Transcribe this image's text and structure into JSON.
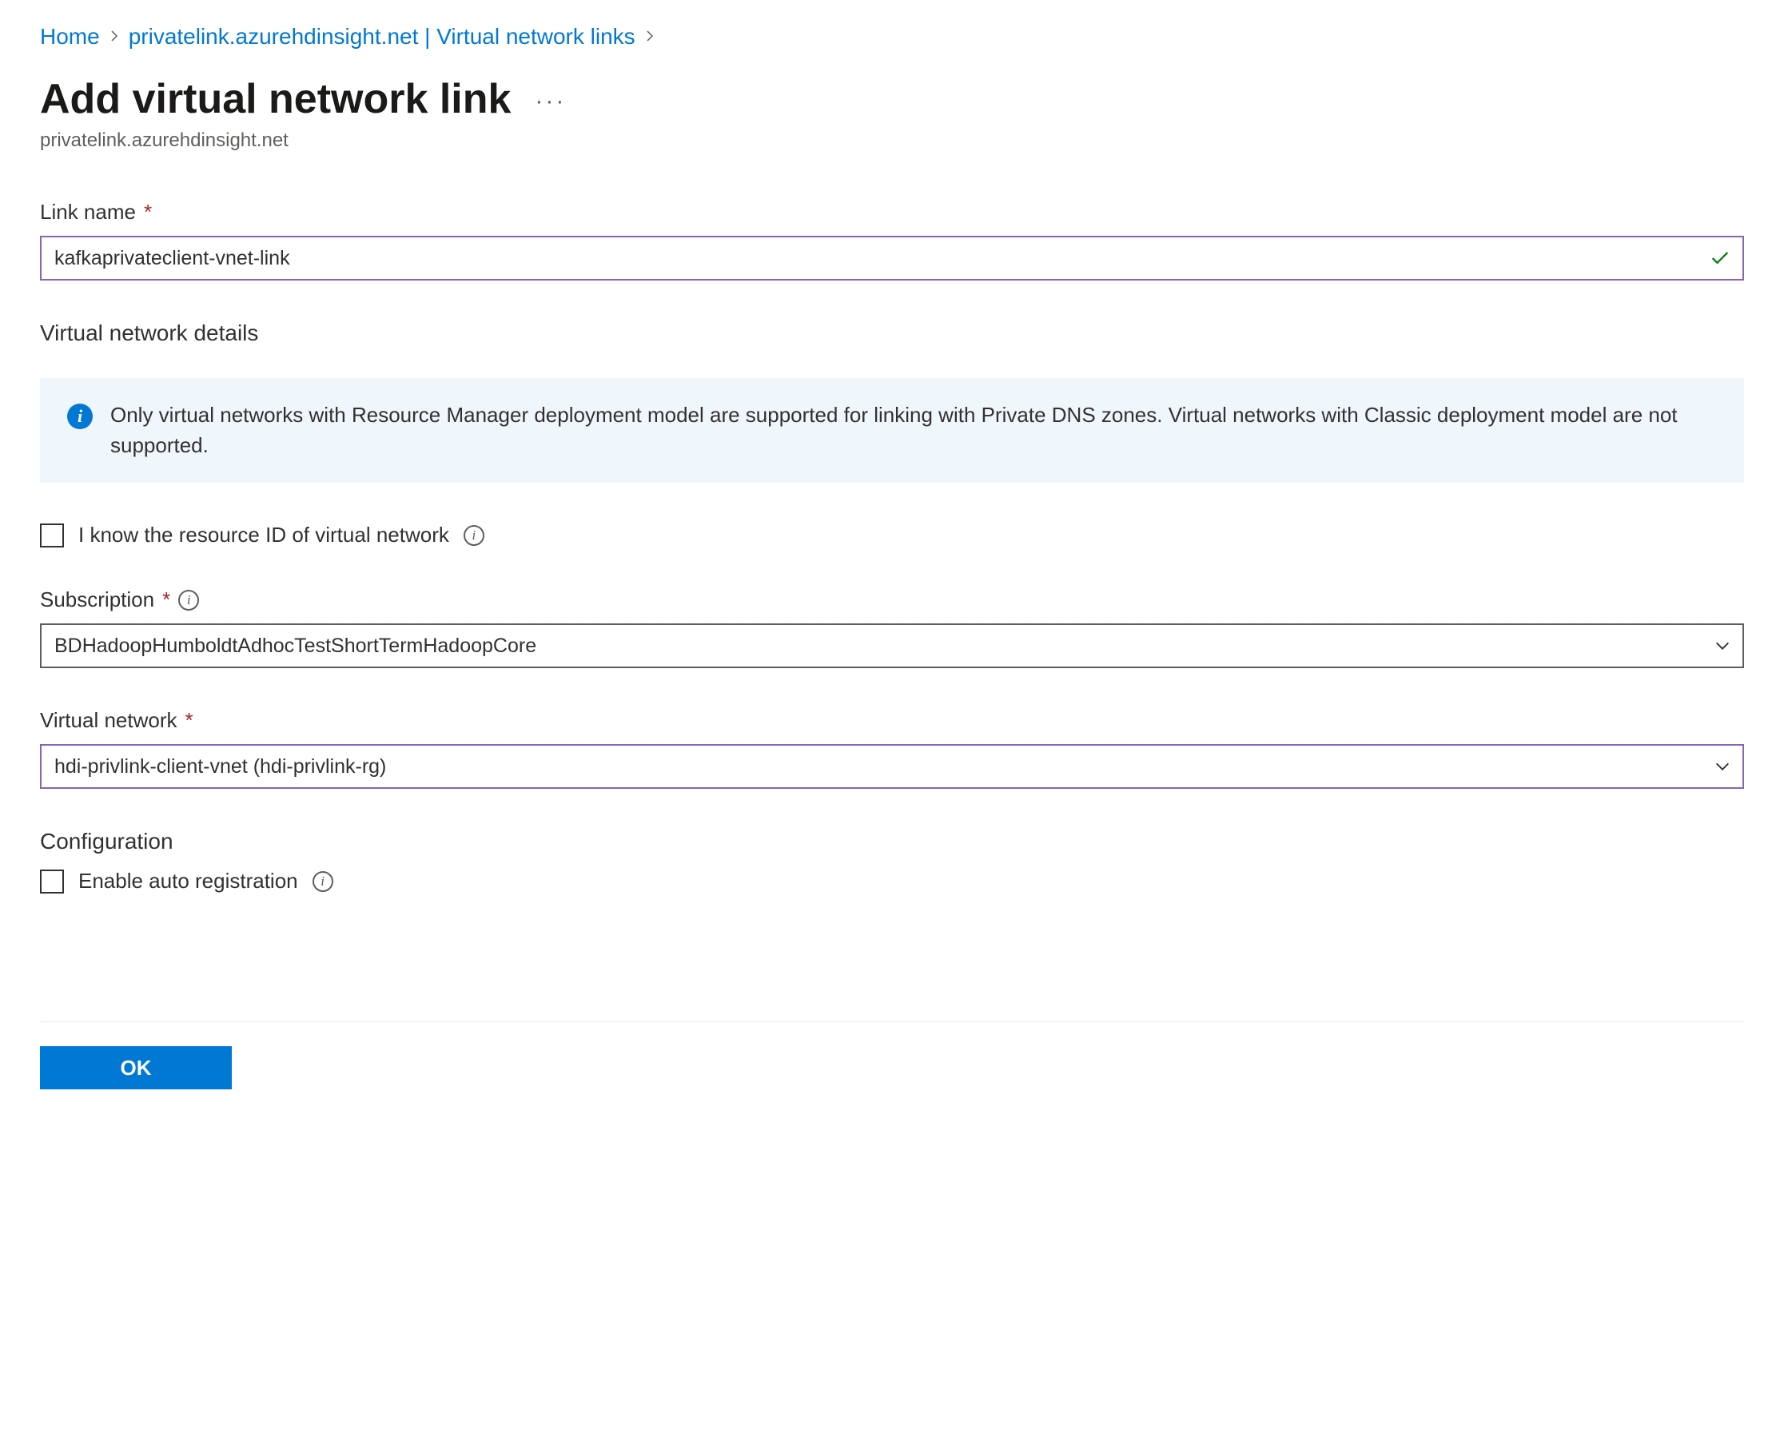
{
  "breadcrumb": {
    "home": "Home",
    "parent": "privatelink.azurehdinsight.net | Virtual network links"
  },
  "header": {
    "title": "Add virtual network link",
    "subtitle": "privatelink.azurehdinsight.net"
  },
  "form": {
    "link_name_label": "Link name",
    "link_name_value": "kafkaprivateclient-vnet-link",
    "vnet_details_heading": "Virtual network details",
    "info_text": "Only virtual networks with Resource Manager deployment model are supported for linking with Private DNS zones. Virtual networks with Classic deployment model are not supported.",
    "know_resource_id_label": "I know the resource ID of virtual network",
    "subscription_label": "Subscription",
    "subscription_value": "BDHadoopHumboldtAdhocTestShortTermHadoopCore",
    "vnet_label": "Virtual network",
    "vnet_value": "hdi-privlink-client-vnet (hdi-privlink-rg)",
    "config_heading": "Configuration",
    "auto_reg_label": "Enable auto registration"
  },
  "footer": {
    "ok_label": "OK"
  },
  "colors": {
    "primary": "#0078d4",
    "validated_border": "#8764b8",
    "required": "#a4262c",
    "success": "#107c10"
  }
}
